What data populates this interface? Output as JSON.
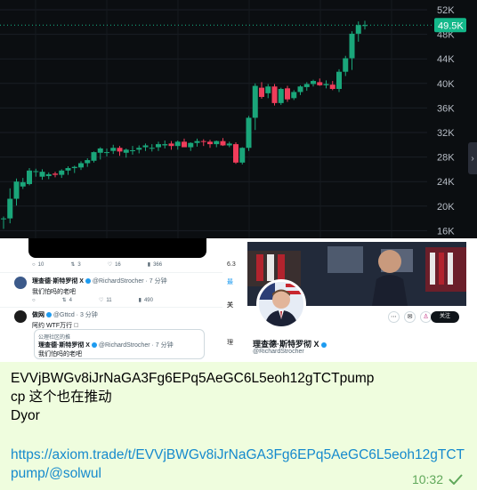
{
  "chart": {
    "price_levels": [
      "52K",
      "48K",
      "44K",
      "40K",
      "36K",
      "32K",
      "28K",
      "24K",
      "20K",
      "16K"
    ],
    "current_price_tag": "49.5K",
    "colors": {
      "up": "#1aa67a",
      "down": "#ef3d5b",
      "bg": "#0b0e11",
      "tag": "#14b88a"
    },
    "candles": [
      [
        17.9,
        18.3,
        16.3,
        18.0
      ],
      [
        18.0,
        22.9,
        17.2,
        21.2
      ],
      [
        21.2,
        24.5,
        20.1,
        24.0
      ],
      [
        23.2,
        24.6,
        22.8,
        23.9
      ],
      [
        23.6,
        26.2,
        23.4,
        25.8
      ],
      [
        25.6,
        26.1,
        24.8,
        25.7
      ],
      [
        24.8,
        26.0,
        24.3,
        25.6
      ],
      [
        24.9,
        25.5,
        24.4,
        25.2
      ],
      [
        25.3,
        25.6,
        24.7,
        25.1
      ],
      [
        25.1,
        26.0,
        24.6,
        25.8
      ],
      [
        25.8,
        26.5,
        25.1,
        26.2
      ],
      [
        26.2,
        26.6,
        25.4,
        26.4
      ],
      [
        26.3,
        27.3,
        25.9,
        27.0
      ],
      [
        27.0,
        27.8,
        26.4,
        27.5
      ],
      [
        27.4,
        28.9,
        27.1,
        28.8
      ],
      [
        28.7,
        29.6,
        27.6,
        29.4
      ],
      [
        28.8,
        29.4,
        28.1,
        28.8
      ],
      [
        29.0,
        30.0,
        28.5,
        29.5
      ],
      [
        29.5,
        29.8,
        28.2,
        28.9
      ],
      [
        28.7,
        29.4,
        27.9,
        29.2
      ],
      [
        29.0,
        29.8,
        28.4,
        29.1
      ],
      [
        29.2,
        29.9,
        28.6,
        29.5
      ],
      [
        29.6,
        30.2,
        29.0,
        29.9
      ],
      [
        29.4,
        30.1,
        28.9,
        29.5
      ],
      [
        29.6,
        30.5,
        29.0,
        30.1
      ],
      [
        29.9,
        30.7,
        29.4,
        30.1
      ],
      [
        30.2,
        30.6,
        29.2,
        29.8
      ],
      [
        29.8,
        30.7,
        29.2,
        30.5
      ],
      [
        30.5,
        31.0,
        29.6,
        29.6
      ],
      [
        29.6,
        30.4,
        29.0,
        30.3
      ],
      [
        30.3,
        31.0,
        29.7,
        30.6
      ],
      [
        30.6,
        30.9,
        29.8,
        30.5
      ],
      [
        30.5,
        30.8,
        29.5,
        30.1
      ],
      [
        30.1,
        30.7,
        29.6,
        30.6
      ],
      [
        30.6,
        31.1,
        29.8,
        29.9
      ],
      [
        29.9,
        30.5,
        29.6,
        30.2
      ],
      [
        30.1,
        30.4,
        26.9,
        27.1
      ],
      [
        27.1,
        29.6,
        26.8,
        29.5
      ],
      [
        29.5,
        34.7,
        29.0,
        34.4
      ],
      [
        34.4,
        40.0,
        32.4,
        39.6
      ],
      [
        39.3,
        40.2,
        37.5,
        37.8
      ],
      [
        38.4,
        39.9,
        37.6,
        39.5
      ],
      [
        39.5,
        39.9,
        36.4,
        36.8
      ],
      [
        36.8,
        39.3,
        36.5,
        39.1
      ],
      [
        39.2,
        39.6,
        37.0,
        37.4
      ],
      [
        37.6,
        38.9,
        37.3,
        38.6
      ],
      [
        38.6,
        39.7,
        38.1,
        39.5
      ],
      [
        39.4,
        40.2,
        38.8,
        39.9
      ],
      [
        39.9,
        40.6,
        39.5,
        40.4
      ],
      [
        40.2,
        40.8,
        39.6,
        39.7
      ],
      [
        39.7,
        40.5,
        39.2,
        39.9
      ],
      [
        39.8,
        40.4,
        38.9,
        39.1
      ],
      [
        39.1,
        42.3,
        38.6,
        41.9
      ],
      [
        41.9,
        44.5,
        41.2,
        44.1
      ],
      [
        44.1,
        48.5,
        42.2,
        48.1
      ],
      [
        48.1,
        50.1,
        46.8,
        49.5
      ],
      [
        49.5,
        50.2,
        48.8,
        49.5
      ]
    ]
  },
  "tweets": {
    "actions_top": [
      "10",
      "3",
      "16",
      "366"
    ],
    "tweet1": {
      "name": "理查德·斯特罗彻 X",
      "handle": "@RichardStrocher · 7 分钟",
      "text": "我们怕吗的老吧"
    },
    "actions_mid": [
      "4",
      "11",
      "490"
    ],
    "tweet2": {
      "name": "做网",
      "handle": "@Gttcd · 3 分钟",
      "text": "阿约 WTF万行 ⃒"
    },
    "quote": {
      "context": "公理社区的推",
      "name": "理查德·斯特罗彻 X",
      "handle": "@RichardStrocher · 7 分钟",
      "text": "我们怕吗的老吧"
    },
    "side": [
      "6.3",
      "最",
      "关",
      "理"
    ]
  },
  "profile": {
    "name": "理查德·斯特罗彻 X",
    "handle": "@RichardStrocher",
    "follow_label": "关注"
  },
  "message": {
    "text": "EVVjBWGv8iJrNaGA3Fg6EPq5AeGC6L5eoh12gTCTpump\ncp 这个也在推动\nDyor",
    "link": "https://axiom.trade/t/EVVjBWGv8iJrNaGA3Fg6EPq5AeGC6L5eoh12gTCTpump/@solwul",
    "time": "10:32"
  }
}
